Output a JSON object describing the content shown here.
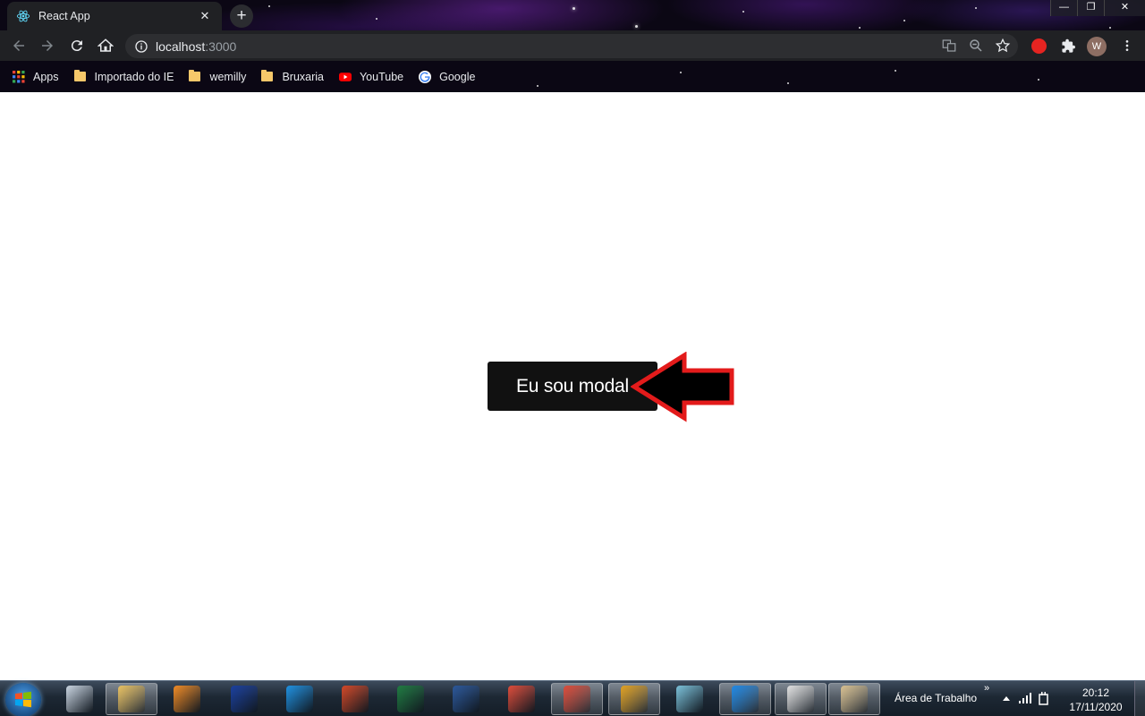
{
  "browser": {
    "tab": {
      "title": "React App",
      "close": "✕"
    },
    "new_tab": "+",
    "window_controls": {
      "minimize": "—",
      "restore": "❐",
      "close": "✕"
    },
    "omnibox": {
      "host": "localhost",
      "port": ":3000"
    },
    "profile_initial": "W",
    "bookmarks": [
      {
        "label": "Apps",
        "icon": "apps-grid-icon"
      },
      {
        "label": "Importado do IE",
        "icon": "folder-icon"
      },
      {
        "label": "wemilly",
        "icon": "folder-icon"
      },
      {
        "label": "Bruxaria",
        "icon": "folder-icon"
      },
      {
        "label": "YouTube",
        "icon": "youtube-icon"
      },
      {
        "label": "Google",
        "icon": "google-icon"
      }
    ]
  },
  "page": {
    "modal_text": "Eu sou modal",
    "arrow_color": "#e31b1b"
  },
  "taskbar": {
    "desktop_label": "Área de Trabalho",
    "chevron": "»",
    "time": "20:12",
    "date": "17/11/2020",
    "apps": [
      {
        "icon": "snipping-tool-icon",
        "color": "#c9d4e0"
      },
      {
        "icon": "file-explorer-icon",
        "color": "#e8c060"
      },
      {
        "icon": "media-player-icon",
        "color": "#f08a24"
      },
      {
        "icon": "scanner-app-icon",
        "color": "#1a3f9e"
      },
      {
        "icon": "internet-explorer-icon",
        "color": "#1e90e0"
      },
      {
        "icon": "powerpoint-icon",
        "color": "#d24726"
      },
      {
        "icon": "excel-icon",
        "color": "#1f7a40"
      },
      {
        "icon": "word-icon",
        "color": "#2b579a"
      },
      {
        "icon": "chrome-icon",
        "color": "#dd4b39"
      },
      {
        "icon": "chrome-profile-icon",
        "color": "#dd4b39"
      },
      {
        "icon": "git-icon",
        "color": "#e0a020"
      },
      {
        "icon": "note-app-icon",
        "color": "#7ac0d8"
      },
      {
        "icon": "vscode-icon",
        "color": "#1e88e5"
      },
      {
        "icon": "terminal-window-icon",
        "color": "#e0e0e0"
      },
      {
        "icon": "paint-icon",
        "color": "#d8c090"
      }
    ]
  }
}
